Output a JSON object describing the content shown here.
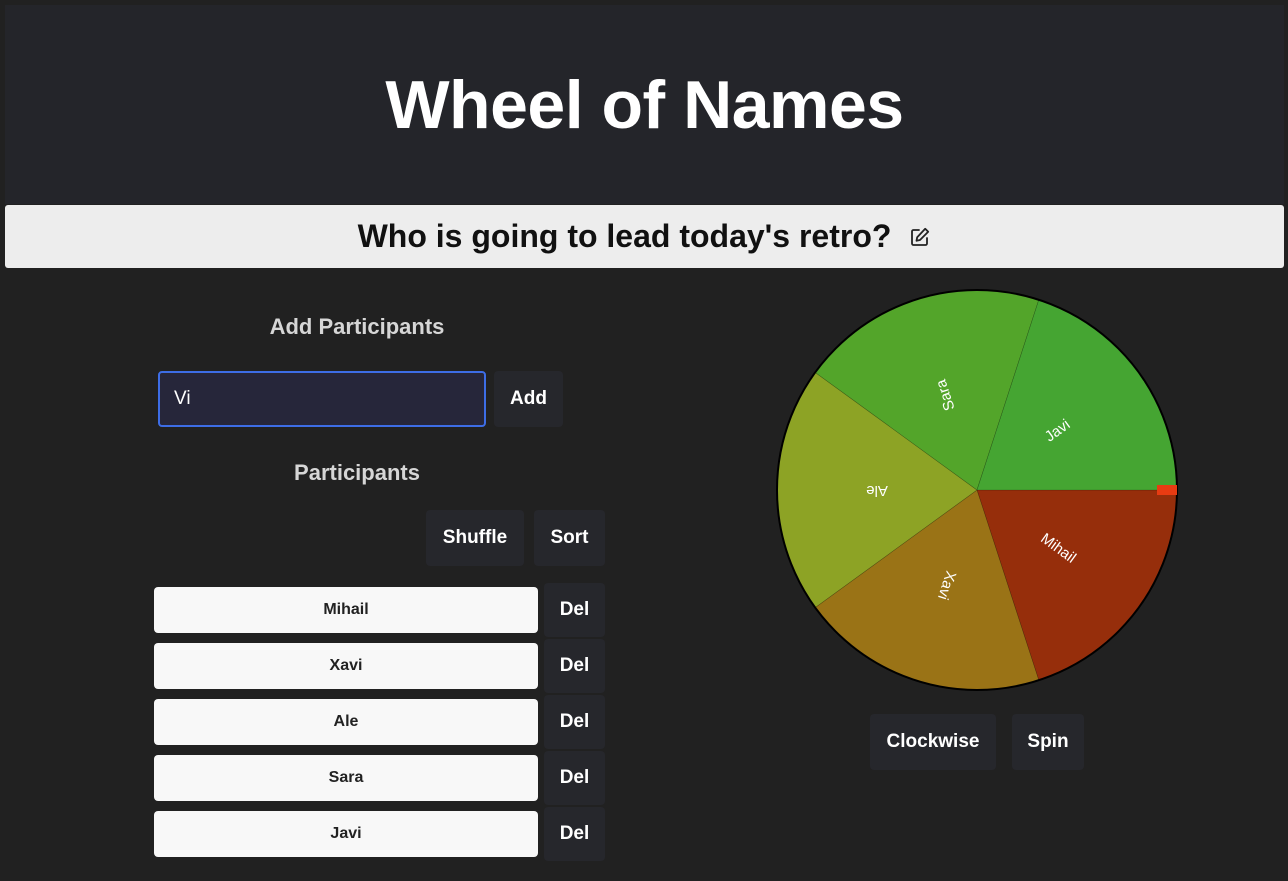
{
  "app": {
    "title": "Wheel of Names"
  },
  "question": {
    "text": "Who is going to lead today's retro?",
    "edit_icon": "edit-icon"
  },
  "add_section": {
    "title": "Add Participants",
    "input_value": "Vi",
    "add_label": "Add"
  },
  "participants_section": {
    "title": "Participants",
    "shuffle_label": "Shuffle",
    "sort_label": "Sort",
    "delete_label": "Del",
    "items": [
      {
        "name": "Mihail"
      },
      {
        "name": "Xavi"
      },
      {
        "name": "Ale"
      },
      {
        "name": "Sara"
      },
      {
        "name": "Javi"
      }
    ]
  },
  "wheel": {
    "segments": [
      {
        "label": "Mihail",
        "color": "#962e0b"
      },
      {
        "label": "Xavi",
        "color": "#9a7316"
      },
      {
        "label": "Ale",
        "color": "#8da325"
      },
      {
        "label": "Sara",
        "color": "#53a52a"
      },
      {
        "label": "Javi",
        "color": "#45a532"
      }
    ],
    "pointer_color": "#e83b12",
    "direction_label": "Clockwise",
    "spin_label": "Spin"
  },
  "colors": {
    "background": "#212121",
    "header": "#24252a",
    "question_bar": "#ededed",
    "button": "#26272c",
    "input_border": "#3d6de6"
  }
}
